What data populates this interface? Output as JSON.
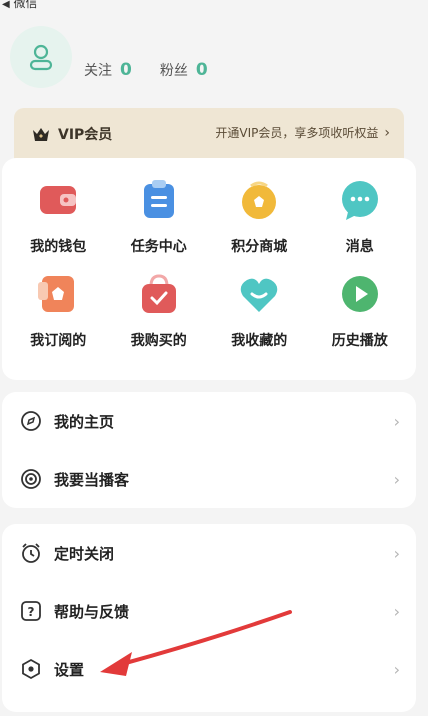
{
  "top": {
    "back_label": "微信"
  },
  "profile": {
    "following_label": "关注",
    "following_count": "0",
    "followers_label": "粉丝",
    "followers_count": "0"
  },
  "vip": {
    "title": "VIP会员",
    "promo": "开通VIP会员，享多项收听权益"
  },
  "grid": [
    {
      "name": "wallet",
      "label": "我的钱包",
      "icon": "wallet-icon",
      "color": "#e05a5a"
    },
    {
      "name": "task-center",
      "label": "任务中心",
      "icon": "clipboard-icon",
      "color": "#4a90e2"
    },
    {
      "name": "points-mall",
      "label": "积分商城",
      "icon": "points-icon",
      "color": "#f1b93a"
    },
    {
      "name": "messages",
      "label": "消息",
      "icon": "chat-bubble-icon",
      "color": "#4fc6c3"
    },
    {
      "name": "subscribed",
      "label": "我订阅的",
      "icon": "subscribe-icon",
      "color": "#f0845a"
    },
    {
      "name": "purchased",
      "label": "我购买的",
      "icon": "shopping-bag-icon",
      "color": "#e05a5a"
    },
    {
      "name": "favorites",
      "label": "我收藏的",
      "icon": "heart-icon",
      "color": "#4fc6c3"
    },
    {
      "name": "history",
      "label": "历史播放",
      "icon": "play-icon",
      "color": "#4eb56f"
    }
  ],
  "list1": [
    {
      "name": "homepage",
      "label": "我的主页",
      "icon": "compass-icon"
    },
    {
      "name": "become-podcaster",
      "label": "我要当播客",
      "icon": "broadcast-icon"
    }
  ],
  "list2": [
    {
      "name": "sleep-timer",
      "label": "定时关闭",
      "icon": "alarm-clock-icon"
    },
    {
      "name": "help-feedback",
      "label": "帮助与反馈",
      "icon": "question-icon"
    },
    {
      "name": "settings",
      "label": "设置",
      "icon": "hexagon-settings-icon"
    }
  ],
  "annotation_color": "#e23a3a"
}
